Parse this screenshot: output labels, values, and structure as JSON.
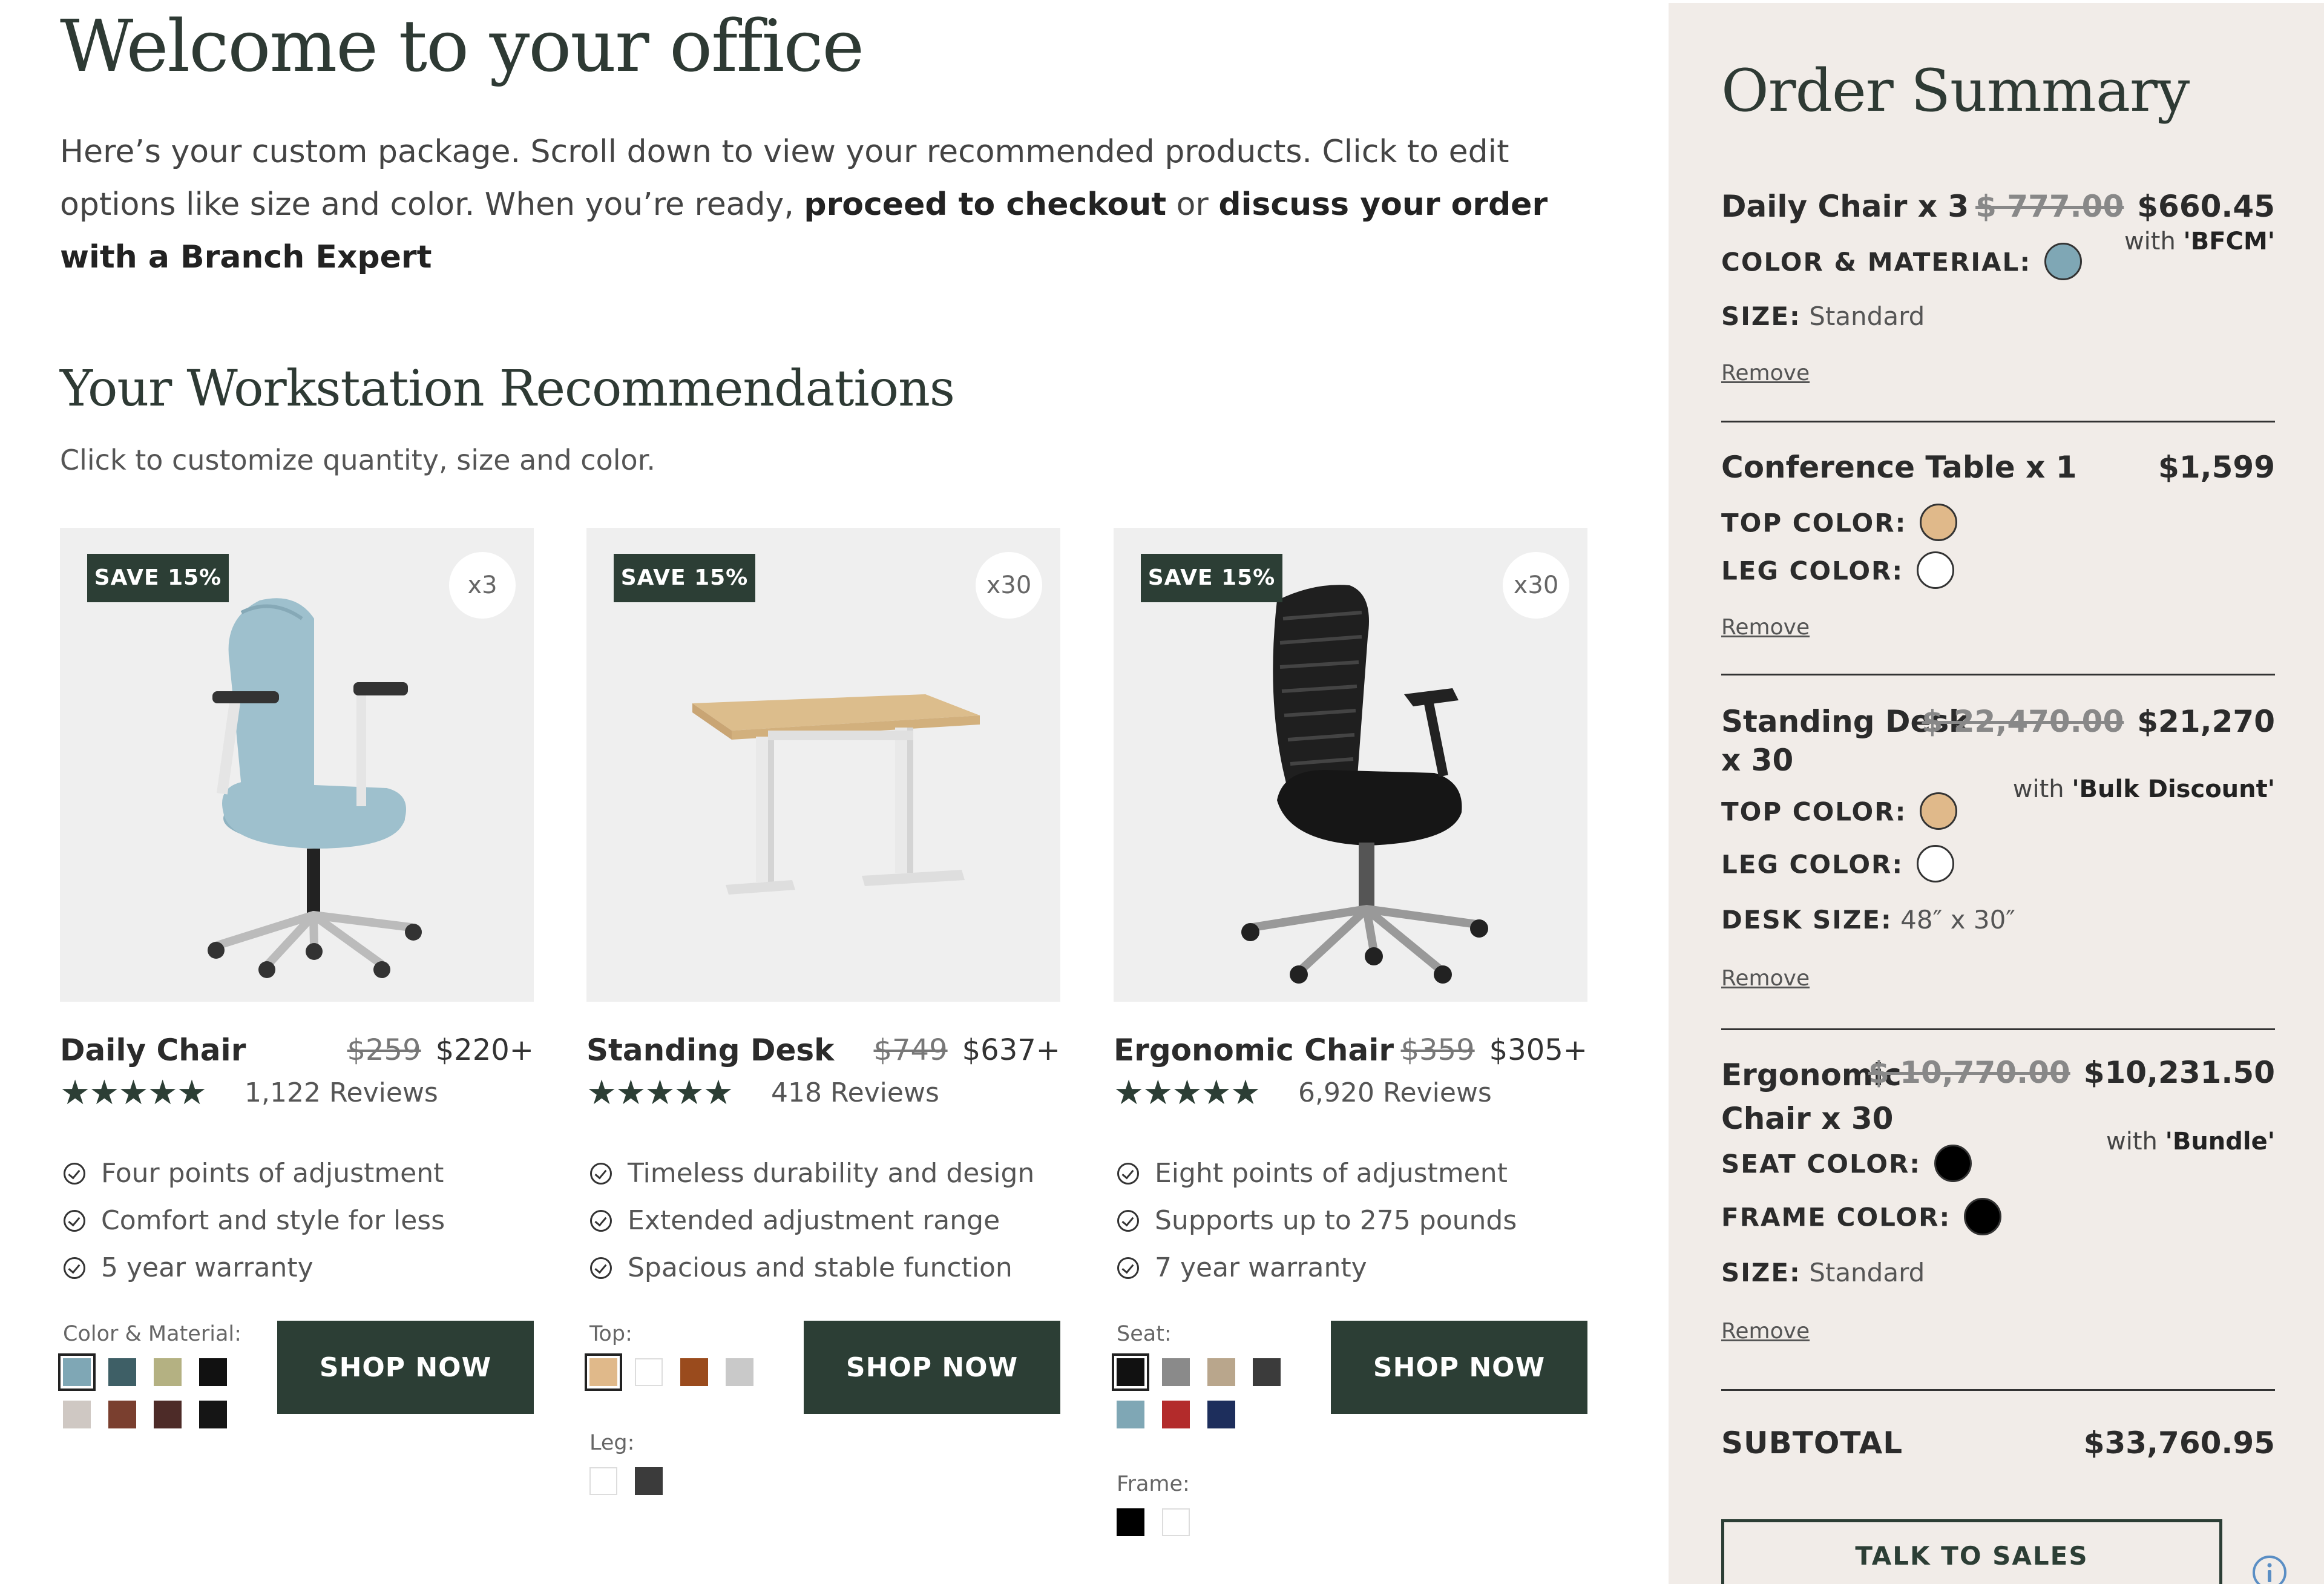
{
  "page": {
    "title": "Welcome to your office",
    "intro_text": "Here’s your custom package. Scroll down to view your recommended products. Click to edit options like size and color. When you’re ready, ",
    "intro_link_checkout": "proceed to checkout",
    "intro_or": " or ",
    "intro_link_expert": "discuss your order with a Branch Expert",
    "section_title": "Your Workstation Recommendations",
    "section_subtitle": "Click to customize quantity, size and color."
  },
  "products": [
    {
      "badge": "SAVE 15%",
      "qty": "x3",
      "name": "Daily Chair",
      "old_price": "$259",
      "price": "$220+",
      "stars": "★★★★★",
      "rating": 4.5,
      "reviews": "1,122 Reviews",
      "features": [
        "Four points of adjustment",
        "Comfort and style for less",
        "5 year warranty"
      ],
      "option_groups": [
        {
          "label": "Color & Material:",
          "swatches": [
            "#7fa7b5",
            "#3e5f66",
            "#b4b182",
            "#111111",
            "#cfc8c3",
            "#7a3f2f",
            "#4d2b28",
            "#151515"
          ],
          "selected": 0
        }
      ],
      "button": "SHOP NOW"
    },
    {
      "badge": "SAVE 15%",
      "qty": "x30",
      "name": "Standing Desk",
      "old_price": "$749",
      "price": "$637+",
      "stars": "★★★★★",
      "rating": 4.5,
      "reviews": "418 Reviews",
      "features": [
        "Timeless durability and design",
        "Extended adjustment range",
        "Spacious and stable function"
      ],
      "option_groups": [
        {
          "label": "Top:",
          "swatches": [
            "#e0b98a",
            "#ffffff",
            "#9a4b1d",
            "#c9c9c9"
          ],
          "selected": 0
        },
        {
          "label": "Leg:",
          "swatches": [
            "#ffffff",
            "#3b3b3b"
          ],
          "selected": -1
        }
      ],
      "button": "SHOP NOW"
    },
    {
      "badge": "SAVE 15%",
      "qty": "x30",
      "name": "Ergonomic Chair",
      "old_price": "$359",
      "price": "$305+",
      "stars": "★★★★★",
      "rating": 4.5,
      "reviews": "6,920 Reviews",
      "features": [
        "Eight points of adjustment",
        "Supports up to 275 pounds",
        "7 year warranty"
      ],
      "option_groups": [
        {
          "label": "Seat:",
          "swatches": [
            "#111111",
            "#8a8a8a",
            "#b9a68c",
            "#3b3b3b",
            "#7fa7b5",
            "#b32b2b",
            "#1d2e5c"
          ],
          "selected": 0
        },
        {
          "label": "Frame:",
          "swatches": [
            "#000000",
            "#ffffff"
          ],
          "selected": -1
        }
      ],
      "button": "SHOP NOW"
    }
  ],
  "summary": {
    "title": "Order Summary",
    "items": [
      {
        "name": "Daily Chair  x 3",
        "old_price": "$ 777.00",
        "price": "$660.45",
        "note_prefix": "with ",
        "note_code": "'BFCM'",
        "attrs": [
          {
            "key": "COLOR & MATERIAL:",
            "dot": "#7fa7b5"
          },
          {
            "key": "SIZE:",
            "value": "Standard"
          }
        ],
        "remove": "Remove"
      },
      {
        "name": "Conference Table  x 1",
        "old_price": "",
        "price": "$1,599",
        "note_prefix": "",
        "note_code": "",
        "attrs": [
          {
            "key": "TOP COLOR:",
            "dot": "#e0b98a"
          },
          {
            "key": "LEG COLOR:",
            "dot": "#ffffff"
          }
        ],
        "remove": "Remove"
      },
      {
        "name": "Standing Desk  x 30",
        "old_price": "$ 22,470.00",
        "price": "$21,270",
        "note_prefix": "with ",
        "note_code": "'Bulk Discount'",
        "attrs": [
          {
            "key": "TOP COLOR:",
            "dot": "#e0b98a"
          },
          {
            "key": "LEG COLOR:",
            "dot": "#ffffff"
          },
          {
            "key": "DESK SIZE:",
            "value": "48″ x 30″"
          }
        ],
        "remove": "Remove"
      },
      {
        "name": "Ergonomic Chair  x 30",
        "old_price": "$ 10,770.00",
        "price": "$10,231.50",
        "note_prefix": "with ",
        "note_code": "'Bundle'",
        "attrs": [
          {
            "key": "SEAT COLOR:",
            "dot": "#000000"
          },
          {
            "key": "FRAME COLOR:",
            "dot": "#000000"
          },
          {
            "key": "SIZE:",
            "value": "Standard"
          }
        ],
        "remove": "Remove"
      }
    ],
    "subtotal_label": "SUBTOTAL",
    "subtotal_value": "$33,760.95",
    "talk_button": "TALK TO SALES"
  }
}
